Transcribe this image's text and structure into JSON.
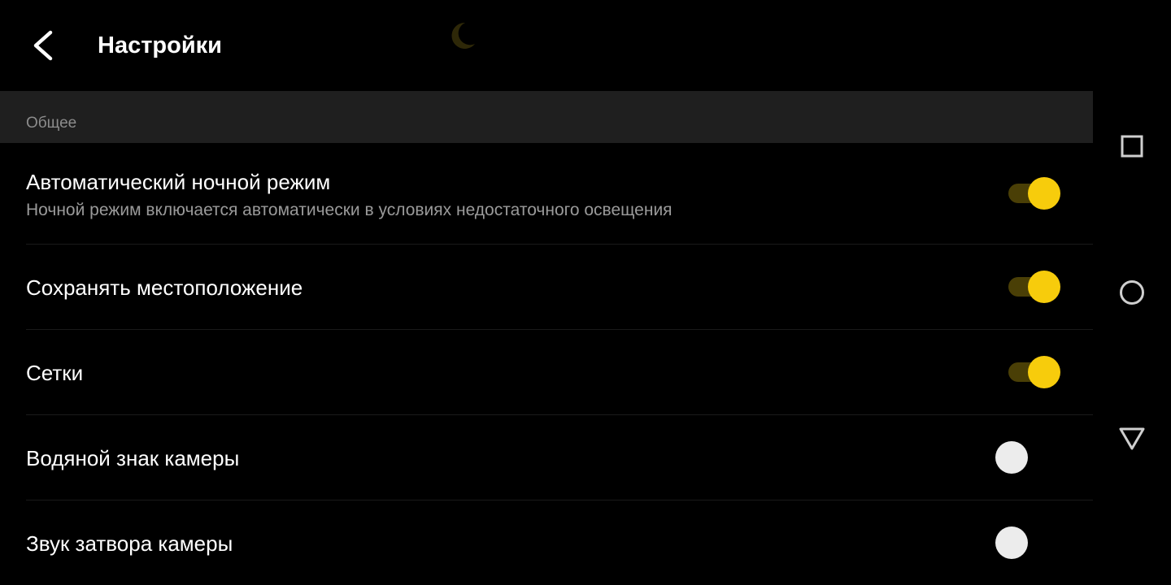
{
  "header": {
    "title": "Настройки",
    "back_icon": "chevron-left-icon",
    "night_icon": "moon-icon",
    "accent_color": "#f7cc0c"
  },
  "section": {
    "label": "Общее"
  },
  "settings": [
    {
      "title": "Автоматический ночной режим",
      "subtitle": "Ночной режим включается автоматически в условиях недостаточного освещения",
      "enabled": true
    },
    {
      "title": "Сохранять местоположение",
      "subtitle": "",
      "enabled": true
    },
    {
      "title": "Сетки",
      "subtitle": "",
      "enabled": true
    },
    {
      "title": "Водяной знак камеры",
      "subtitle": "",
      "enabled": false
    },
    {
      "title": "Звук затвора камеры",
      "subtitle": "",
      "enabled": false
    }
  ],
  "navbar": {
    "recents_icon": "square-icon",
    "home_icon": "circle-icon",
    "back_icon": "triangle-icon"
  }
}
